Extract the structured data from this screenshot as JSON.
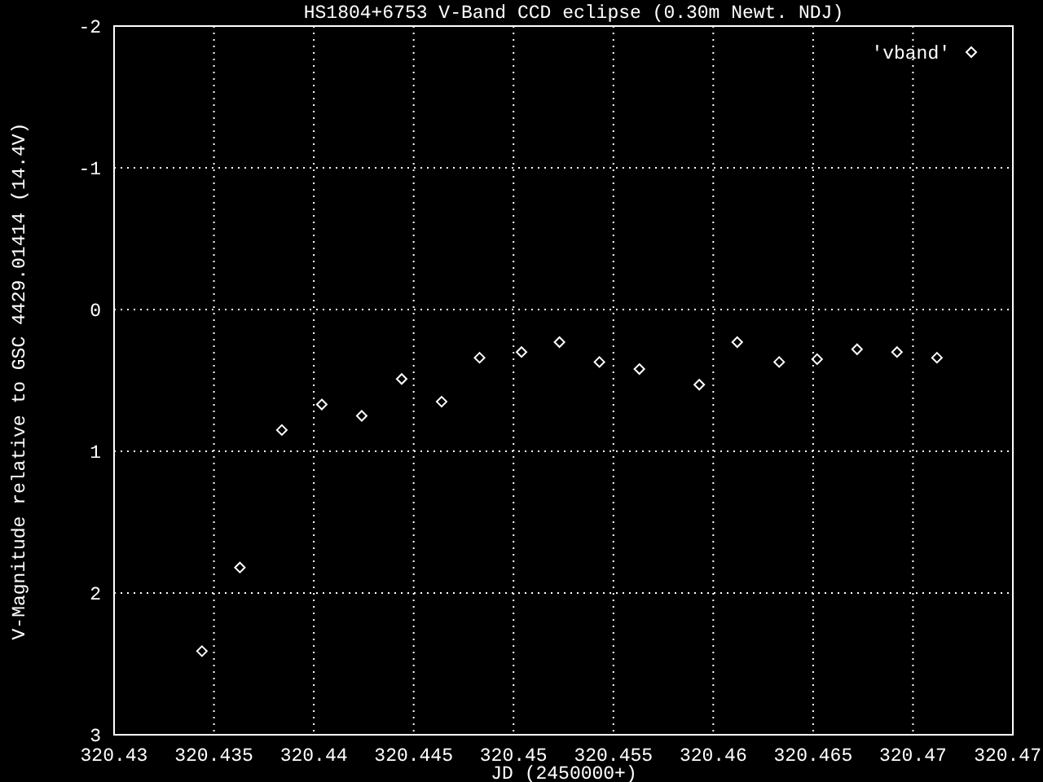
{
  "chart_data": {
    "type": "scatter",
    "title": "HS1804+6753 V-Band CCD eclipse (0.30m Newt. NDJ)",
    "xlabel": "JD (2450000+)",
    "ylabel": "V-Magnitude relative to GSC 4429.01414 (14.4V)",
    "xlim": [
      320.43,
      320.475
    ],
    "ylim": [
      3,
      -2
    ],
    "grid": true,
    "xticks": [
      320.43,
      320.435,
      320.44,
      320.445,
      320.45,
      320.455,
      320.46,
      320.465,
      320.47,
      {
        "value": 320.475,
        "label": "320.47"
      }
    ],
    "yticks": [
      -2,
      -1,
      0,
      1,
      2,
      3
    ],
    "series": [
      {
        "name": "'vband'",
        "color": "#ffffff",
        "x": [
          320.4344,
          320.4363,
          320.4384,
          320.4404,
          320.4424,
          320.4444,
          320.4464,
          320.4483,
          320.4504,
          320.4523,
          320.4543,
          320.4563,
          320.4593,
          320.4612,
          320.4633,
          320.4652,
          320.4672,
          320.4692,
          320.4712
        ],
        "values": [
          2.41,
          1.82,
          0.85,
          0.67,
          0.75,
          0.49,
          0.65,
          0.34,
          0.3,
          0.23,
          0.37,
          0.42,
          0.53,
          0.23,
          0.37,
          0.35,
          0.28,
          0.3,
          0.34
        ]
      }
    ]
  }
}
